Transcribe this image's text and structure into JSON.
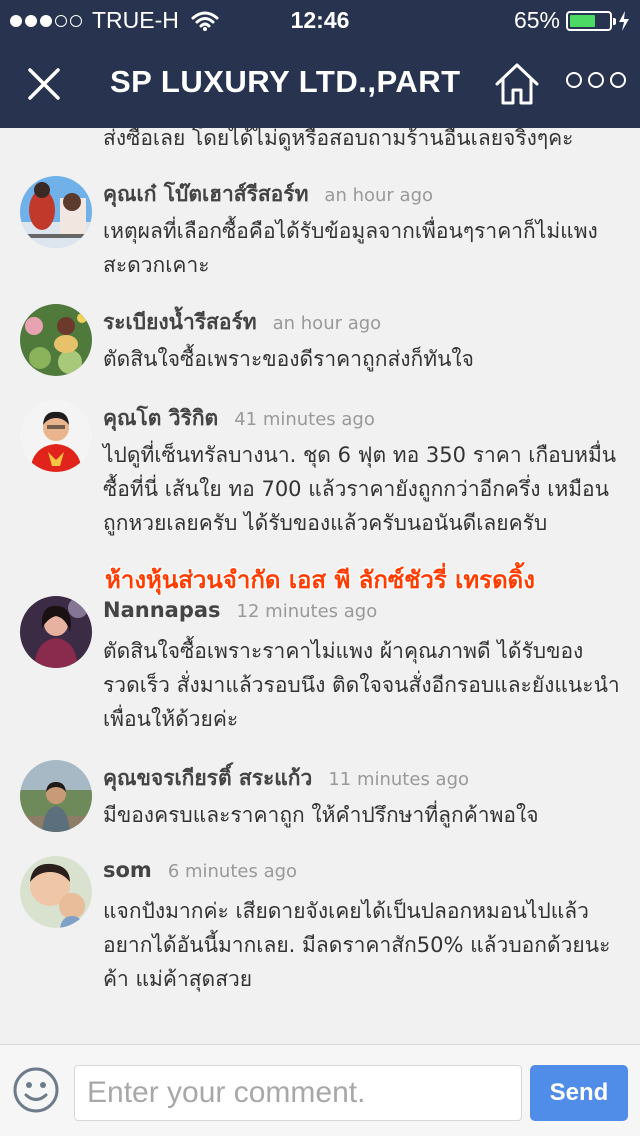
{
  "status_bar": {
    "carrier": "TRUE-H",
    "time": "12:46",
    "battery_percent": "65%",
    "battery_level": 0.65,
    "signal_bars": 3,
    "signal_total": 5
  },
  "nav": {
    "title": "SP LUXURY LTD.,PART",
    "close_icon": "close-icon",
    "home_icon": "home-icon",
    "more_icon": "more-icon"
  },
  "comments": {
    "cut_text": "ส่งซื้อเลย โดยได้ไม่ดูหรือสอบถามร้านอื่นเลยจริงๆคะ",
    "items": [
      {
        "name": "คุณเก๋ โบ๊ตเฮาส์รีสอร์ท",
        "time": "an hour ago",
        "text": "เหตุผลที่เลือกซื้อคือได้รับข้อมูลจากเพื่อนๆราคาก็ไม่แพงสะดวกเคาะ"
      },
      {
        "name": "ระเบียงน้ำรีสอร์ท",
        "time": "an hour ago",
        "text": "ตัดสินใจซื้อเพราะของดีราคาถูกส่งก็ทันใจ"
      },
      {
        "name": "คุณโต วิริกิต",
        "time": "41 minutes ago",
        "text": "ไปดูที่เซ็นทรัลบางนา. ชุด 6 ฟุต ทอ 350 ราคา เกือบหมื่น ซื้อที่นี่ เส้นใย ทอ 700 แล้วราคายังถูกกว่าอีกครึ่ง เหมือนถูกหวยเลยครับ ได้รับของแล้วครับนอนันดีเลยครับ"
      },
      {
        "name": "Nannapas",
        "time": "12 minutes ago",
        "text": "ตัดสินใจซื้อเพราะราคาไม่แพง ผ้าคุณภาพดี ได้รับของรวดเร็ว สั่งมาแล้วรอบนึง ติดใจจนสั่งอีกรอบและยังแนะนำเพื่อนให้ด้วยค่ะ"
      },
      {
        "name": "คุณขจรเกียรติ์ สระแก้ว",
        "time": "11 minutes ago",
        "text": "มีของครบและราคาถูก ให้คำปรึกษาที่ลูกค้าพอใจ"
      },
      {
        "name": "som",
        "time": "6 minutes ago",
        "text": "แจกปังมากค่ะ เสียดายจังเคยได้เป็นปลอกหมอนไปแล้ว อยากได้อันนี้มากเลย. มีลดราคาสัก50% แล้วบอกด้วยนะค้า แม่ค้าสุดสวย"
      }
    ]
  },
  "watermark": "ห้างหุ้นส่วนจำกัด เอส พี ลักซ์ชัวรี่ เทรดดิ้ง",
  "input_bar": {
    "placeholder": "Enter your comment.",
    "send_label": "Send",
    "emoji_icon": "smiley-icon"
  },
  "colors": {
    "header_bg": "#27334f",
    "send_button": "#4f8de8",
    "watermark": "#ff3d00",
    "battery": "#4cd964"
  }
}
